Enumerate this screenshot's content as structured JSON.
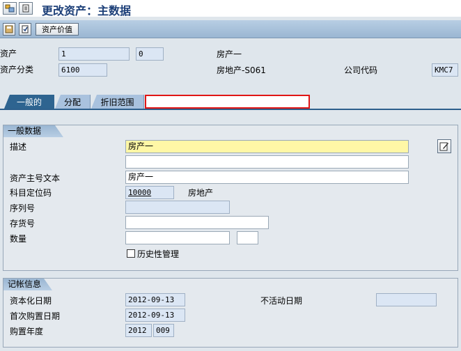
{
  "window": {
    "title": "更改资产：主数据"
  },
  "app_toolbar": {
    "asset_value_button": "资产价值"
  },
  "header": {
    "asset_label": "资产",
    "asset_number": "1",
    "asset_sub_number": "0",
    "asset_description": "房产一",
    "asset_class_label": "资产分类",
    "asset_class": "6100",
    "asset_class_description": "房地产-S061",
    "company_code_label": "公司代码",
    "company_code": "KMC7"
  },
  "tabs": [
    {
      "label": "一般的",
      "active": true
    },
    {
      "label": "分配",
      "active": false
    },
    {
      "label": "折旧范围",
      "active": false
    }
  ],
  "general_data": {
    "title": "一般数据",
    "description_label": "描述",
    "description": "房产一",
    "description_2": "",
    "main_number_text_label": "资产主号文本",
    "main_number_text": "房产一",
    "account_determination_label": "科目定位码",
    "account_determination": "10000",
    "account_determination_text": "房地产",
    "serial_number_label": "序列号",
    "serial_number": "",
    "inventory_number_label": "存货号",
    "inventory_number": "",
    "quantity_label": "数量",
    "quantity": "",
    "quantity_unit": "",
    "historical_mgmt_label": "历史性管理",
    "historical_mgmt_checked": false
  },
  "posting_info": {
    "title": "记帐信息",
    "capitalization_date_label": "资本化日期",
    "capitalization_date": "2012-09-13",
    "inactive_date_label": "不活动日期",
    "inactive_date": "",
    "first_acquisition_label": "首次购置日期",
    "first_acquisition_date": "2012-09-13",
    "acquisition_year_label": "购置年度",
    "acquisition_year": "2012",
    "acquisition_period": "009"
  },
  "colors": {
    "title": "#1c3f78",
    "toolbar": "#9ab6d2",
    "tab_active": "#2e6490",
    "required_field": "#fff7a6",
    "highlight": "#e01515"
  }
}
